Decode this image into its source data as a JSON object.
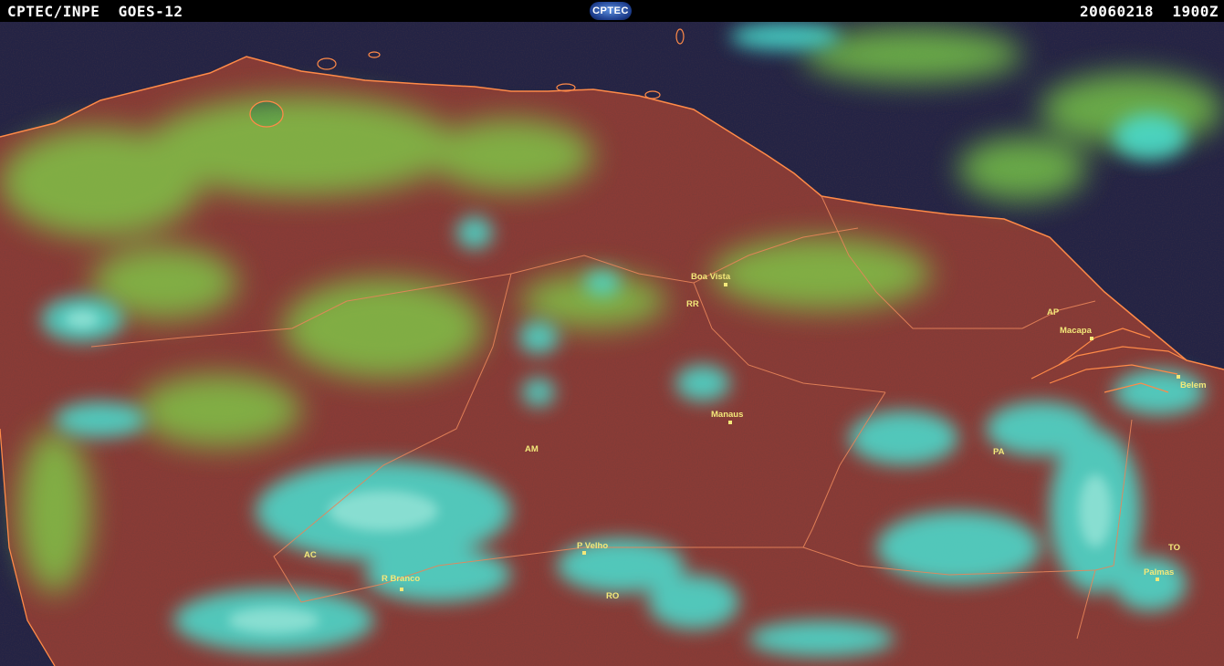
{
  "header": {
    "title_left": "CPTEC/INPE  GOES-12",
    "logo": "CPTEC",
    "timestamp": "20060218  1900Z"
  },
  "colors": {
    "ocean": "#232345",
    "land": "#8a3b36",
    "low_cloud": "#7fd44a",
    "high_cloud": "#49e0d2",
    "coastline": "#ff8a48",
    "label": "#f3e87a"
  },
  "map_labels": {
    "boa_vista": "Boa Vista",
    "rr": "RR",
    "ap": "AP",
    "macapa": "Macapa",
    "belem": "Belem",
    "manaus": "Manaus",
    "am": "AM",
    "pa": "PA",
    "p_velho": "P Velho",
    "ac": "AC",
    "r_branco": "R Branco",
    "ro": "RO",
    "to": "TO",
    "palmas": "Palmas"
  }
}
